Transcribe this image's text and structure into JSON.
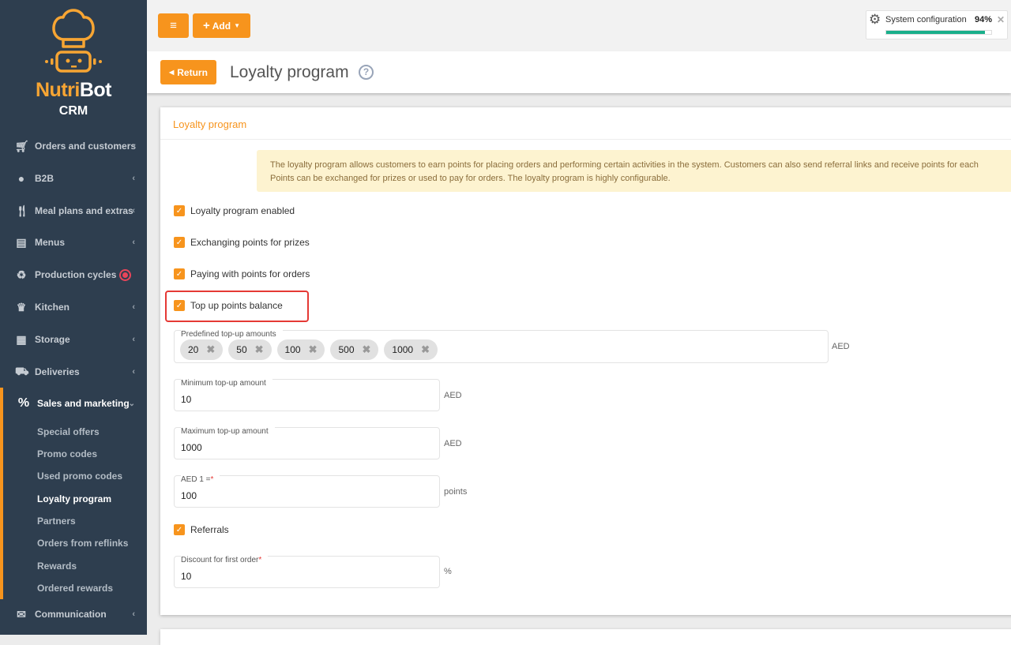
{
  "brand": {
    "name_orange": "Nutri",
    "name_white": "Bot",
    "sub": "CRM"
  },
  "colors": {
    "accent": "#f7941d",
    "sidebar": "#2e3e4f",
    "progress": "#1aaf8b",
    "highlight": "#e53935"
  },
  "sidebar": {
    "items": [
      {
        "label": "Orders and customers",
        "icon": "cart-icon"
      },
      {
        "label": "B2B",
        "icon": "user-icon"
      },
      {
        "label": "Meal plans and extras",
        "icon": "utensils-icon"
      },
      {
        "label": "Menus",
        "icon": "list-icon"
      },
      {
        "label": "Production cycles",
        "icon": "recycle-icon"
      },
      {
        "label": "Kitchen",
        "icon": "chef-hat-icon"
      },
      {
        "label": "Storage",
        "icon": "boxes-icon"
      },
      {
        "label": "Deliveries",
        "icon": "truck-icon"
      },
      {
        "label": "Sales and marketing",
        "icon": "percent-icon"
      },
      {
        "label": "Communication",
        "icon": "envelope-icon"
      }
    ],
    "subitems": [
      "Special offers",
      "Promo codes",
      "Used promo codes",
      "Loyalty program",
      "Partners",
      "Orders from reflinks",
      "Rewards",
      "Ordered rewards"
    ]
  },
  "toolbar": {
    "add_label": "Add"
  },
  "progress": {
    "label": "System configuration",
    "percent_text": "94%",
    "value": 94
  },
  "header": {
    "return_label": "Return",
    "title": "Loyalty program"
  },
  "card": {
    "title": "Loyalty program",
    "info": "The loyalty program allows customers to earn points for placing orders and performing certain activities in the system. Customers can also send referral links and receive points for each",
    "info2": "Points can be exchanged for prizes or used to pay for orders. The loyalty program is highly configurable.",
    "checks": [
      "Loyalty program enabled",
      "Exchanging points for prizes",
      "Paying with points for orders",
      "Top up points balance"
    ],
    "predefined_label": "Predefined top-up amounts",
    "tags": [
      "20",
      "50",
      "100",
      "500",
      "1000"
    ],
    "currency": "AED",
    "min_label": "Minimum top-up amount",
    "min_value": "10",
    "max_label": "Maximum top-up amount",
    "max_value": "1000",
    "rate_label": "AED 1 =",
    "rate_value": "100",
    "rate_unit": "points",
    "referrals_label": "Referrals",
    "discount_label": "Discount for first order",
    "discount_value": "10",
    "discount_unit": "%",
    "required": "*"
  }
}
